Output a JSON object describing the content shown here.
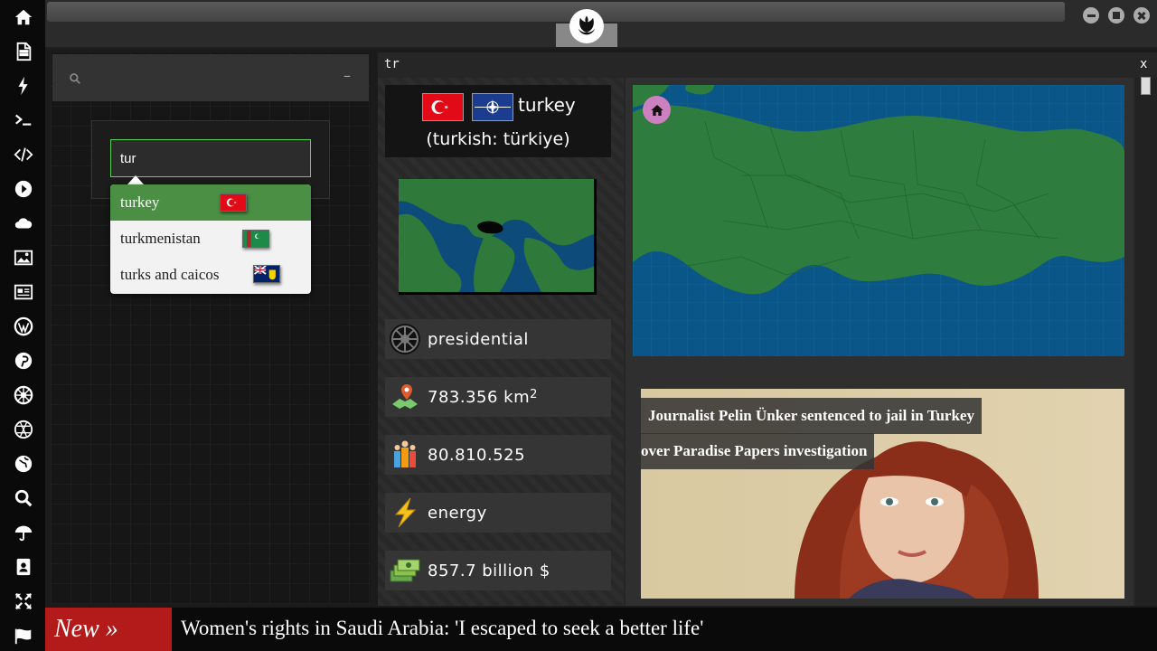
{
  "sidebar": {
    "icons": [
      "home-icon",
      "document-icon",
      "bolt-icon",
      "terminal-icon",
      "code-icon",
      "play-icon",
      "cloud-icon",
      "image-icon",
      "newspaper-icon",
      "wordpress-icon",
      "pinterest-icon",
      "empire-icon",
      "network-icon",
      "globe-icon",
      "search-icon",
      "umbrella-icon",
      "contact-icon",
      "arrows-icon",
      "flag-icon"
    ]
  },
  "search": {
    "value": "tur",
    "suggestions": [
      {
        "label": "turkey",
        "flag": "turkey"
      },
      {
        "label": "turkmenistan",
        "flag": "turkmenistan"
      },
      {
        "label": "turks and caicos",
        "flag": "turks-and-caicos"
      }
    ]
  },
  "left_panel": {
    "collapse_label": "–"
  },
  "main": {
    "title": "tr",
    "close_label": "x",
    "country_name": "turkey",
    "local_name": "(turkish: türkiye)",
    "stats": {
      "government": "presidential",
      "area_value": "783.356 km",
      "area_unit_sup": "2",
      "population": "80.810.525",
      "sector": "energy",
      "gdp": "857.7 billion $"
    },
    "headline_line1": "Journalist Pelin Ünker sentenced to jail in Turkey",
    "headline_line2": "over Paradise Papers investigation"
  },
  "ticker": {
    "label": "New »",
    "text": "Women's rights in Saudi Arabia: 'I escaped to seek a better life'"
  },
  "colors": {
    "accent_green": "#4a8f44",
    "map_land": "#2e7d3f",
    "map_sea": "#0a5688",
    "ticker_red": "#b31a1a"
  }
}
